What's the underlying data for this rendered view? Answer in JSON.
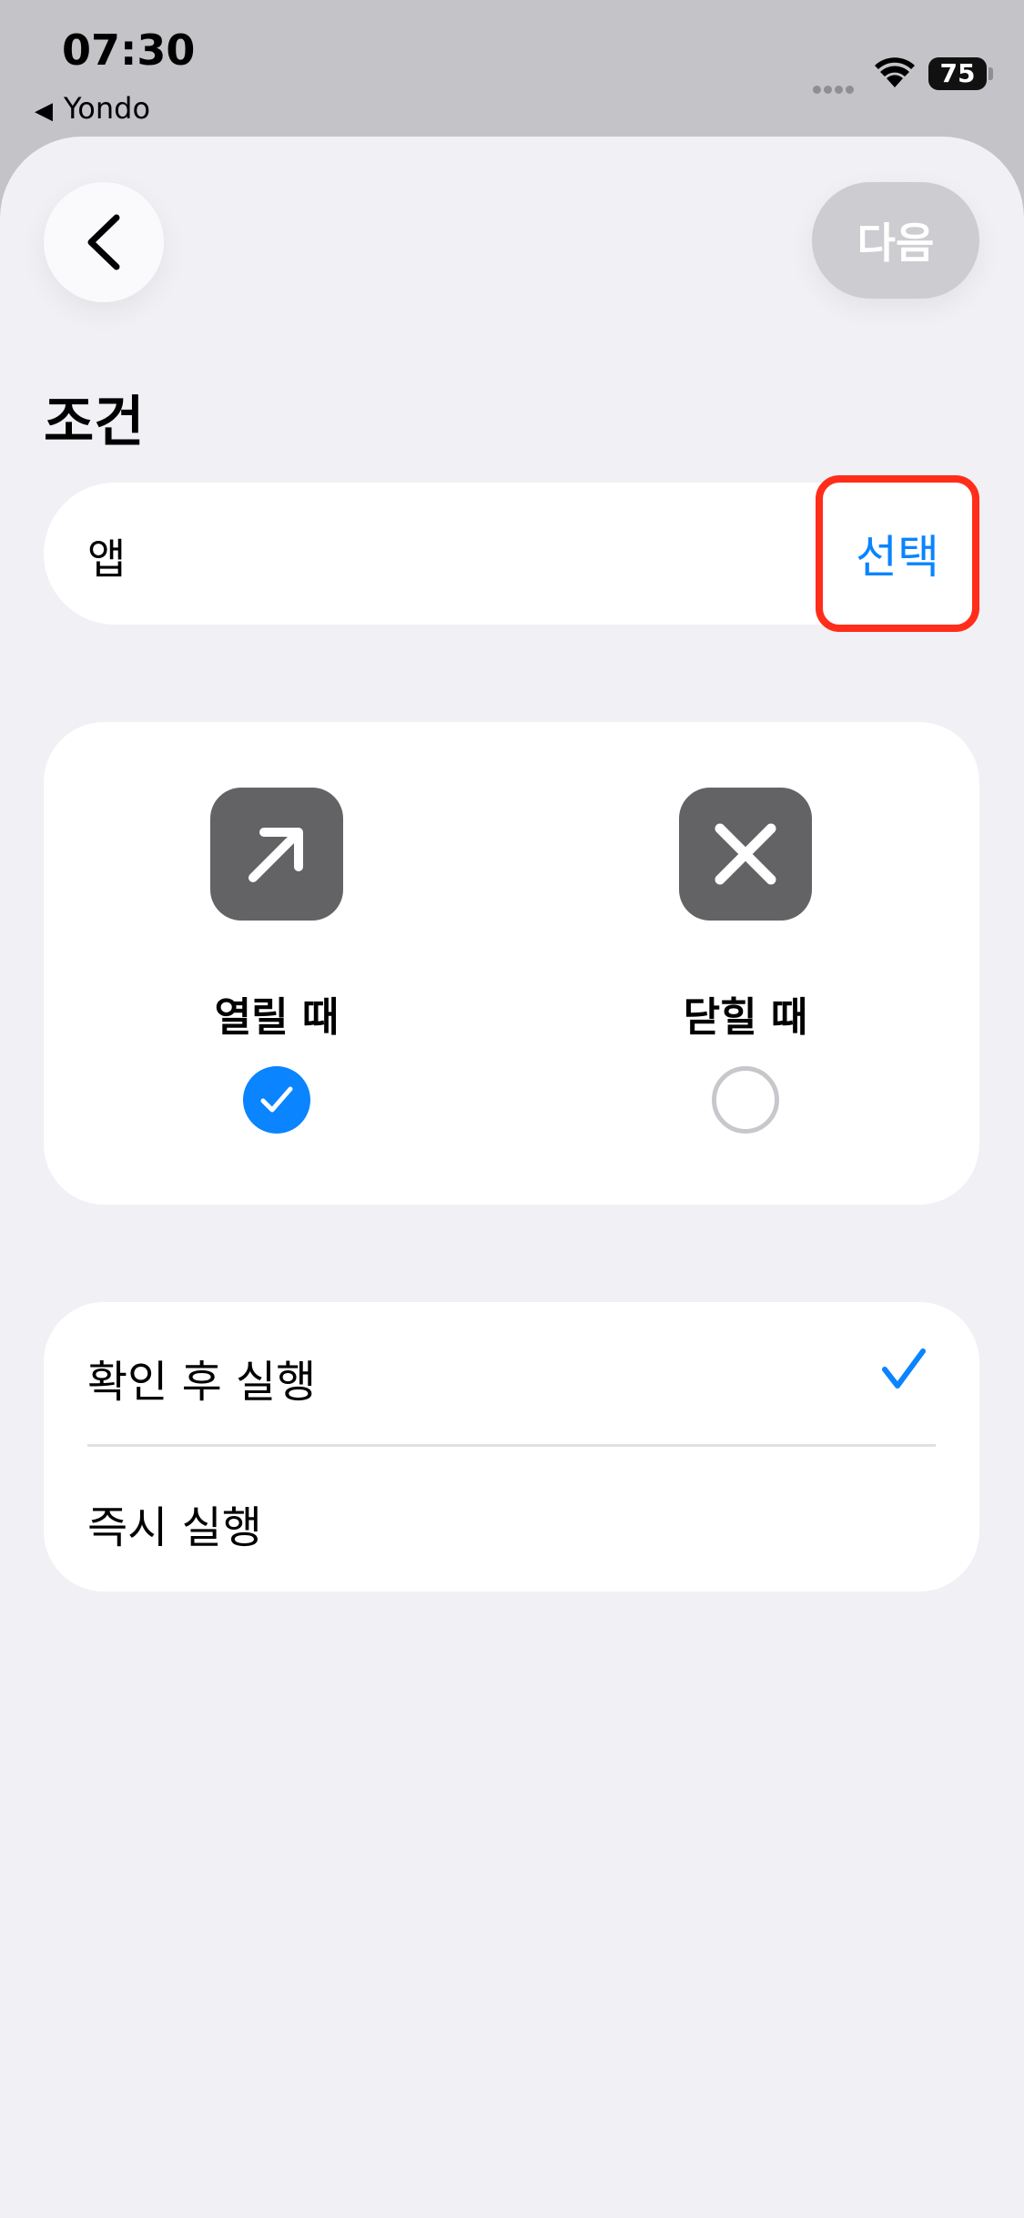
{
  "status": {
    "time": "07:30",
    "back_app": "Yondo",
    "battery": "75"
  },
  "nav": {
    "next_label": "다음"
  },
  "condition": {
    "title": "조건",
    "app_label": "앱",
    "select_label": "선택"
  },
  "triggers": [
    {
      "label": "열릴 때",
      "icon": "arrow-up-right-icon",
      "selected": true
    },
    {
      "label": "닫힐 때",
      "icon": "xmark-icon",
      "selected": false
    }
  ],
  "modes": [
    {
      "label": "확인 후 실행",
      "selected": true
    },
    {
      "label": "즉시 실행",
      "selected": false
    }
  ],
  "colors": {
    "accent": "#0a84ff",
    "highlight": "#ff2d19",
    "icon_bg": "#636366",
    "disabled_button": "#cdcdd1"
  }
}
